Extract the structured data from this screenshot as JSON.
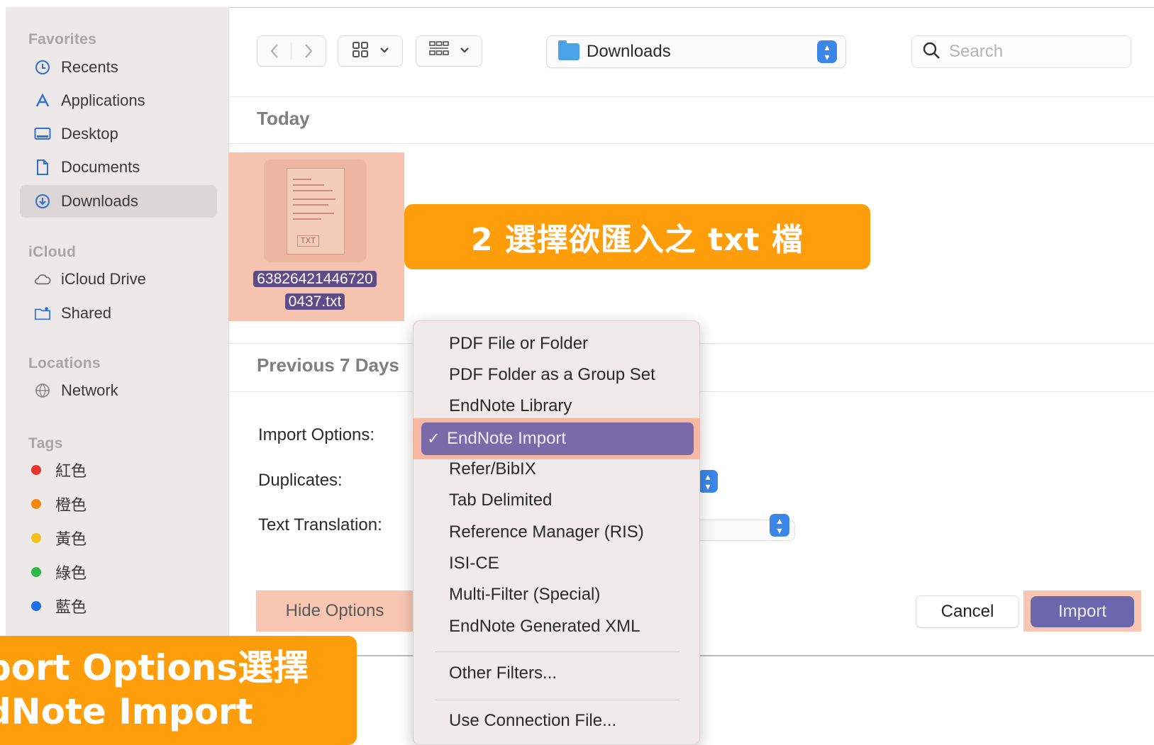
{
  "sidebar": {
    "favorites_title": "Favorites",
    "favorites": [
      {
        "label": "Recents",
        "icon": "clock-icon"
      },
      {
        "label": "Applications",
        "icon": "applications-icon"
      },
      {
        "label": "Desktop",
        "icon": "desktop-icon"
      },
      {
        "label": "Documents",
        "icon": "document-icon"
      },
      {
        "label": "Downloads",
        "icon": "download-icon",
        "selected": true
      }
    ],
    "icloud_title": "iCloud",
    "icloud": [
      {
        "label": "iCloud Drive",
        "icon": "cloud-icon"
      },
      {
        "label": "Shared",
        "icon": "shared-folder-icon"
      }
    ],
    "locations_title": "Locations",
    "locations": [
      {
        "label": "Network",
        "icon": "network-icon"
      }
    ],
    "tags_title": "Tags",
    "tags": [
      {
        "label": "紅色",
        "color": "#e8362f"
      },
      {
        "label": "橙色",
        "color": "#f0890f"
      },
      {
        "label": "黃色",
        "color": "#f2c21a"
      },
      {
        "label": "綠色",
        "color": "#2fb845"
      },
      {
        "label": "藍色",
        "color": "#1f6fe6"
      }
    ]
  },
  "toolbar": {
    "back_icon": "chevron-left-icon",
    "forward_icon": "chevron-right-icon",
    "icon_view_icon": "grid-view-icon",
    "group_icon": "group-by-icon",
    "location": "Downloads",
    "search_placeholder": "Search"
  },
  "files": {
    "group_today": "Today",
    "group_previous": "Previous 7 Days",
    "selected_file": {
      "name_line1": "63826421446720",
      "name_line2": "0437.txt",
      "thumb_label": "TXT"
    }
  },
  "options": {
    "import_options_label": "Import Options:",
    "duplicates_label": "Duplicates:",
    "text_translation_label": "Text Translation:",
    "hide_options": "Hide Options",
    "cancel": "Cancel",
    "import": "Import"
  },
  "menu": {
    "items_before": [
      "PDF File or Folder",
      "PDF Folder as a Group Set",
      "EndNote Library"
    ],
    "selected": "EndNote Import",
    "check": "✓",
    "items_after": [
      "Refer/BibIX",
      "Tab Delimited",
      "Reference Manager (RIS)",
      "ISI-CE",
      "Multi-Filter (Special)",
      "EndNote Generated XML"
    ],
    "other_filters": "Other Filters...",
    "connection_file": "Use Connection File..."
  },
  "callouts": {
    "step2": "2 選擇欲匯入之 txt 檔",
    "step1_line1": "port Options選擇",
    "step1_line2": "dNote Import"
  },
  "colors": {
    "callout": "#ff9d0a",
    "highlight": "#f6b8a3",
    "selection": "#7b6aa8",
    "accent_blue": "#3b86e8"
  }
}
